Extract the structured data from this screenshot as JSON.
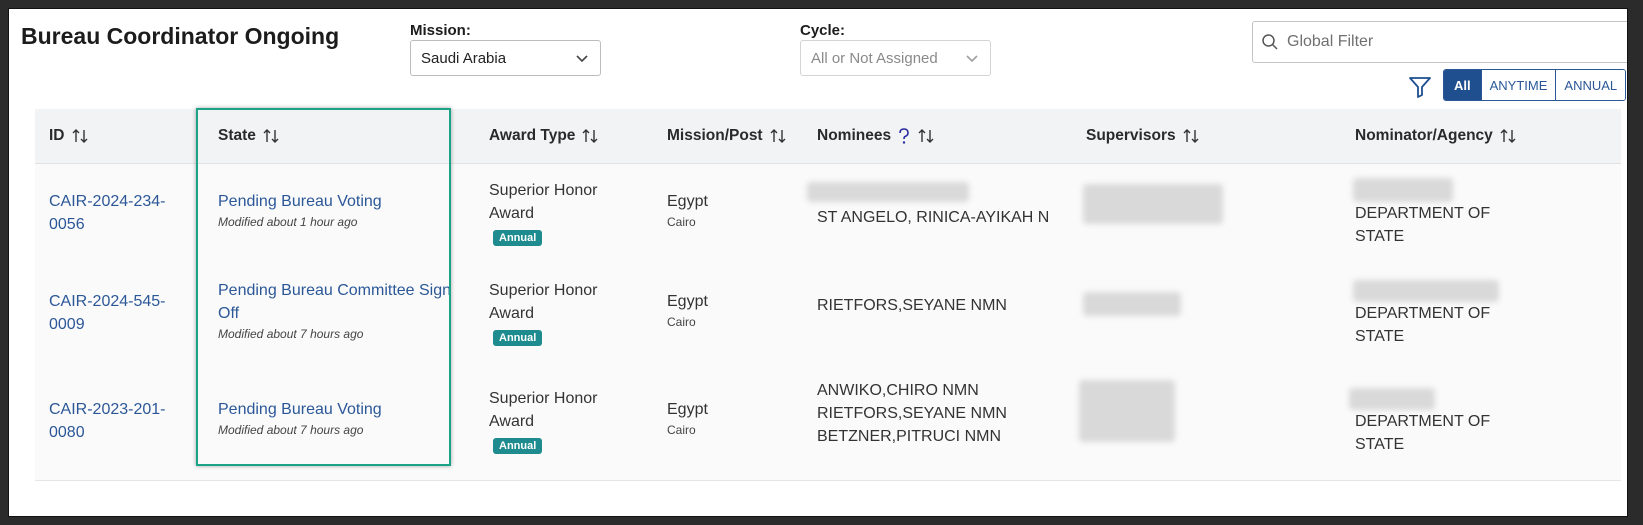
{
  "header": {
    "title": "Bureau Coordinator Ongoing",
    "mission_label": "Mission:",
    "mission_value": "Saudi Arabia",
    "cycle_label": "Cycle:",
    "cycle_value": "All or Not Assigned",
    "search_placeholder": "Global Filter",
    "segments": [
      "All",
      "ANYTIME",
      "ANNUAL"
    ],
    "active_segment": "All"
  },
  "table": {
    "columns": [
      "ID",
      "State",
      "Award Type",
      "Mission/Post",
      "Nominees",
      "Supervisors",
      "Nominator/Agency"
    ],
    "rows": [
      {
        "id_line1": "CAIR-2024-234-",
        "id_line2": "0056",
        "state_line1": "Pending Bureau Voting",
        "state_line2": "",
        "modified": "Modified about 1 hour ago",
        "award_line1": "Superior Honor",
        "award_line2": "Award",
        "badge": "Annual",
        "mission": "Egypt",
        "post": "Cairo",
        "nominees": [
          "ST ANGELO, RINICA-AYIKAH N"
        ],
        "agency_line1": "DEPARTMENT OF",
        "agency_line2": "STATE"
      },
      {
        "id_line1": "CAIR-2024-545-",
        "id_line2": "0009",
        "state_line1": "Pending Bureau Committee Sign",
        "state_line2": "Off",
        "modified": "Modified about 7 hours ago",
        "award_line1": "Superior Honor",
        "award_line2": "Award",
        "badge": "Annual",
        "mission": "Egypt",
        "post": "Cairo",
        "nominees": [
          "RIETFORS,SEYANE NMN"
        ],
        "agency_line1": "DEPARTMENT OF",
        "agency_line2": "STATE"
      },
      {
        "id_line1": "CAIR-2023-201-",
        "id_line2": "0080",
        "state_line1": "Pending Bureau Voting",
        "state_line2": "",
        "modified": "Modified about 7 hours ago",
        "award_line1": "Superior Honor",
        "award_line2": "Award",
        "badge": "Annual",
        "mission": "Egypt",
        "post": "Cairo",
        "nominees": [
          "ANWIKO,CHIRO NMN",
          "RIETFORS,SEYANE NMN",
          "BETZNER,PITRUCI NMN"
        ],
        "agency_line1": "DEPARTMENT OF",
        "agency_line2": "STATE"
      }
    ]
  },
  "colors": {
    "link": "#2b5797",
    "badge": "#1e8b8f",
    "highlight": "#1aa387",
    "active_segment": "#1f4f8f"
  },
  "icons": {
    "search": "search-icon",
    "filter": "filter-icon",
    "sort": "sort-icon",
    "help": "question-mark-icon",
    "chevron": "chevron-down-icon"
  }
}
